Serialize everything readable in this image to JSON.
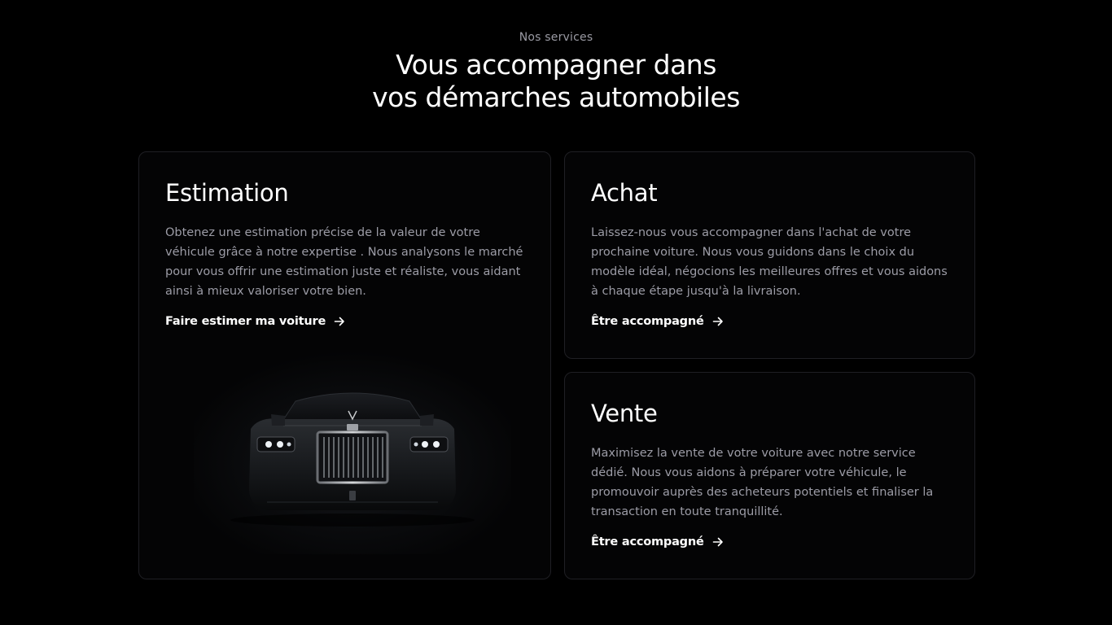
{
  "header": {
    "eyebrow": "Nos services",
    "headline_line1": "Vous accompagner dans",
    "headline_line2": "vos démarches automobiles"
  },
  "cards": {
    "estimation": {
      "title": "Estimation",
      "text": "Obtenez une estimation précise de la valeur de votre véhicule grâce à notre expertise . Nous analysons le marché pour vous offrir une estimation juste et réaliste, vous aidant ainsi à mieux valoriser votre bien.",
      "link": "Faire estimer ma voiture",
      "icon": "arrow-right-icon"
    },
    "achat": {
      "title": "Achat",
      "text": "Laissez-nous vous accompagner dans l'achat de votre prochaine voiture. Nous vous guidons dans le choix du modèle idéal, négocions les meilleures offres et vous aidons à chaque étape jusqu'à la livraison.",
      "link": "Être accompagné",
      "icon": "arrow-right-icon"
    },
    "vente": {
      "title": "Vente",
      "text": "Maximisez la vente de votre voiture avec notre service dédié. Nous vous aidons à préparer votre véhicule, le promouvoir auprès des acheteurs potentiels et finaliser la transaction en toute tranquillité.",
      "link": "Être accompagné",
      "icon": "arrow-right-icon"
    }
  },
  "colors": {
    "background": "#000000",
    "card_border": "#1f1f24",
    "muted_text": "#9c9ca6",
    "heading": "#ffffff"
  }
}
